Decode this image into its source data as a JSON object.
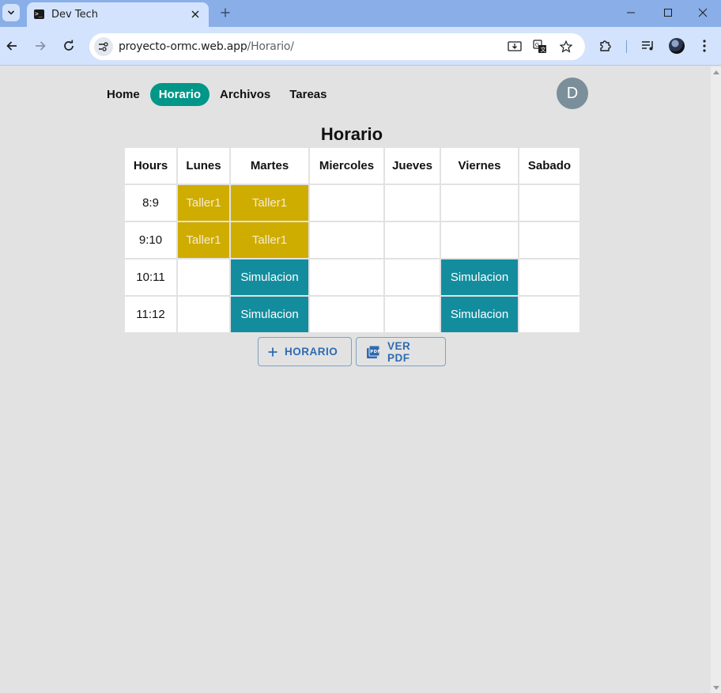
{
  "browser": {
    "tab_title": "Dev Tech",
    "url_host": "proyecto-ormc.web.app",
    "url_path": "/Horario/",
    "colors": {
      "tabbar": "#89aee8",
      "toolbar": "#d3e3fd"
    }
  },
  "nav": {
    "items": [
      {
        "label": "Home",
        "active": false
      },
      {
        "label": "Horario",
        "active": true
      },
      {
        "label": "Archivos",
        "active": false
      },
      {
        "label": "Tareas",
        "active": false
      }
    ],
    "avatar_initial": "D",
    "active_color": "#009688"
  },
  "page": {
    "title": "Horario"
  },
  "schedule": {
    "headers": [
      "Hours",
      "Lunes",
      "Martes",
      "Miercoles",
      "Jueves",
      "Viernes",
      "Sabado"
    ],
    "rows": [
      {
        "hour": "8:9",
        "cells": [
          "Taller1",
          "Taller1",
          "",
          "",
          "",
          ""
        ]
      },
      {
        "hour": "9:10",
        "cells": [
          "Taller1",
          "Taller1",
          "",
          "",
          "",
          ""
        ]
      },
      {
        "hour": "10:11",
        "cells": [
          "",
          "Simulacion",
          "",
          "",
          "Simulacion",
          ""
        ]
      },
      {
        "hour": "11:12",
        "cells": [
          "",
          "Simulacion",
          "",
          "",
          "Simulacion",
          ""
        ]
      }
    ],
    "colors": {
      "Taller1": "#cfac00",
      "Simulacion": "#138d9e"
    }
  },
  "actions": {
    "add_label": "HORARIO",
    "pdf_label": "VER PDF",
    "add_icon": "plus-icon",
    "pdf_icon": "pdf-icon"
  }
}
